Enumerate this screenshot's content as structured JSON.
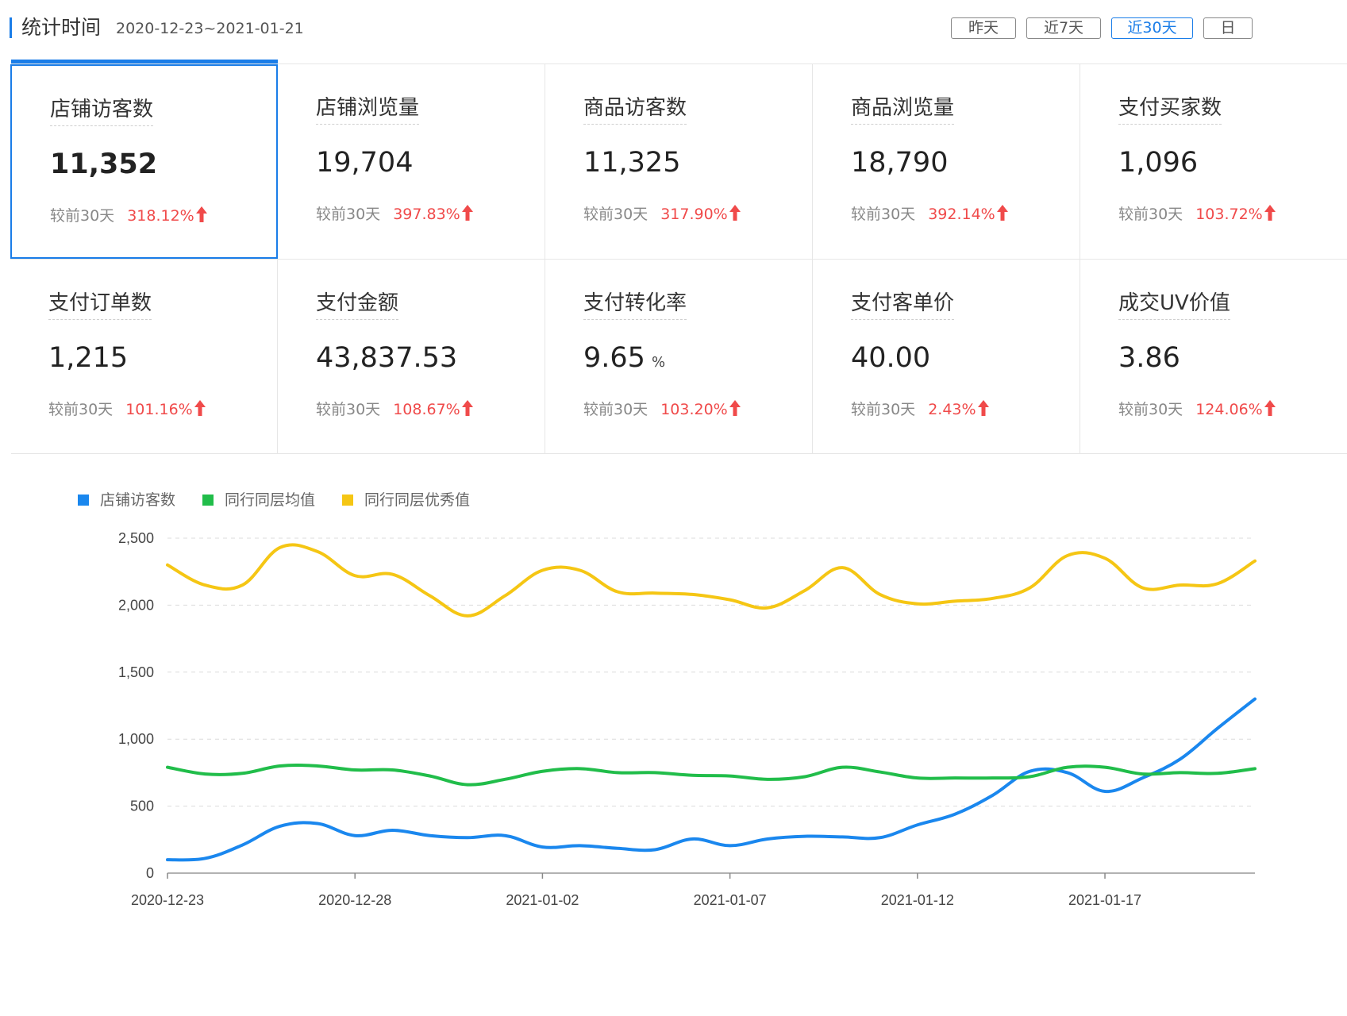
{
  "header": {
    "title": "统计时间",
    "date_range": "2020-12-23~2021-01-21",
    "buttons": [
      {
        "label": "昨天",
        "active": false
      },
      {
        "label": "近7天",
        "active": false
      },
      {
        "label": "近30天",
        "active": true
      },
      {
        "label": "日",
        "active": false
      }
    ]
  },
  "compare_label": "较前30天",
  "metrics": [
    {
      "label": "店铺访客数",
      "value": "11,352",
      "unit": "",
      "change": "318.12%",
      "selected": true
    },
    {
      "label": "店铺浏览量",
      "value": "19,704",
      "unit": "",
      "change": "397.83%",
      "selected": false
    },
    {
      "label": "商品访客数",
      "value": "11,325",
      "unit": "",
      "change": "317.90%",
      "selected": false
    },
    {
      "label": "商品浏览量",
      "value": "18,790",
      "unit": "",
      "change": "392.14%",
      "selected": false
    },
    {
      "label": "支付买家数",
      "value": "1,096",
      "unit": "",
      "change": "103.72%",
      "selected": false
    },
    {
      "label": "支付订单数",
      "value": "1,215",
      "unit": "",
      "change": "101.16%",
      "selected": false
    },
    {
      "label": "支付金额",
      "value": "43,837.53",
      "unit": "",
      "change": "108.67%",
      "selected": false
    },
    {
      "label": "支付转化率",
      "value": "9.65",
      "unit": "%",
      "change": "103.20%",
      "selected": false
    },
    {
      "label": "支付客单价",
      "value": "40.00",
      "unit": "",
      "change": "2.43%",
      "selected": false
    },
    {
      "label": "成交UV价值",
      "value": "3.86",
      "unit": "",
      "change": "124.06%",
      "selected": false
    }
  ],
  "colors": {
    "accent": "#1a7de8",
    "increase": "#f04a4a",
    "series_blue": "#1a87ee",
    "series_green": "#21bd4a",
    "series_yellow": "#f5c614"
  },
  "chart_data": {
    "type": "line",
    "x": [
      "2020-12-23",
      "2020-12-24",
      "2020-12-25",
      "2020-12-26",
      "2020-12-27",
      "2020-12-28",
      "2020-12-29",
      "2020-12-30",
      "2020-12-31",
      "2021-01-01",
      "2021-01-02",
      "2021-01-03",
      "2021-01-04",
      "2021-01-05",
      "2021-01-06",
      "2021-01-07",
      "2021-01-08",
      "2021-01-09",
      "2021-01-10",
      "2021-01-11",
      "2021-01-12",
      "2021-01-13",
      "2021-01-14",
      "2021-01-15",
      "2021-01-16",
      "2021-01-17",
      "2021-01-18",
      "2021-01-19",
      "2021-01-20",
      "2021-01-21"
    ],
    "xticks": [
      "2020-12-23",
      "2020-12-28",
      "2021-01-02",
      "2021-01-07",
      "2021-01-12",
      "2021-01-17"
    ],
    "yticks": [
      0,
      500,
      1000,
      1500,
      2000,
      2500
    ],
    "ylim": [
      0,
      2500
    ],
    "grid": true,
    "legend_position": "top-left",
    "series": [
      {
        "name": "店铺访客数",
        "color": "#1a87ee",
        "values": [
          100,
          110,
          210,
          350,
          370,
          280,
          320,
          280,
          265,
          280,
          195,
          205,
          185,
          175,
          255,
          205,
          255,
          275,
          270,
          265,
          360,
          440,
          580,
          760,
          750,
          610,
          710,
          850,
          1080,
          1300
        ]
      },
      {
        "name": "同行同层均值",
        "color": "#21bd4a",
        "values": [
          790,
          740,
          745,
          800,
          800,
          770,
          770,
          725,
          660,
          700,
          760,
          780,
          750,
          750,
          730,
          725,
          700,
          720,
          790,
          755,
          710,
          710,
          710,
          720,
          790,
          790,
          740,
          750,
          745,
          780
        ]
      },
      {
        "name": "同行同层优秀值",
        "color": "#f5c614",
        "values": [
          2300,
          2150,
          2150,
          2430,
          2400,
          2220,
          2230,
          2070,
          1920,
          2070,
          2260,
          2260,
          2100,
          2090,
          2080,
          2040,
          1980,
          2110,
          2280,
          2080,
          2010,
          2030,
          2050,
          2130,
          2370,
          2350,
          2130,
          2150,
          2160,
          2330
        ]
      }
    ]
  }
}
